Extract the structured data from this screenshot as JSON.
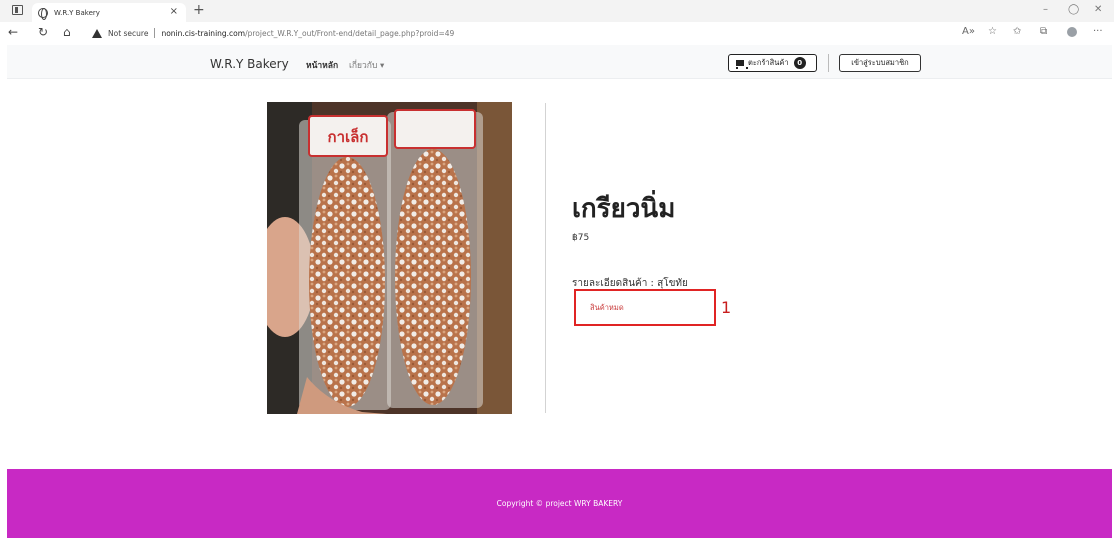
{
  "browser": {
    "tab_title": "W.R.Y Bakery",
    "tab_close": "×",
    "new_tab": "+",
    "not_secure": "Not secure",
    "url_host": "nonin.cis-training.com",
    "url_path": "/project_W.R.Y_out/Front-end/detail_page.php?proid=49",
    "win_minimize": "–",
    "win_restore": "◯",
    "win_close": "✕"
  },
  "nav": {
    "brand": "W.R.Y Bakery",
    "home": "หน้าหลัก",
    "about": "เกี่ยวกับ ▾",
    "cart_label": "ตะกร้าสินค้า",
    "cart_count": "0",
    "member_button": "เข้าสู่ระบบสมาชิก"
  },
  "product": {
    "name": "เกรียวนิ่ม",
    "price": "฿75",
    "detail": "รายละเอียดสินค้า : สุโขทัย",
    "status": "สินค้าหมด",
    "image_label": "กาเล็ก"
  },
  "annotation": {
    "number": "1",
    "color": "#e02424"
  },
  "footer": {
    "copyright": "Copyright © project WRY BAKERY",
    "bg_color": "#c829c4"
  }
}
